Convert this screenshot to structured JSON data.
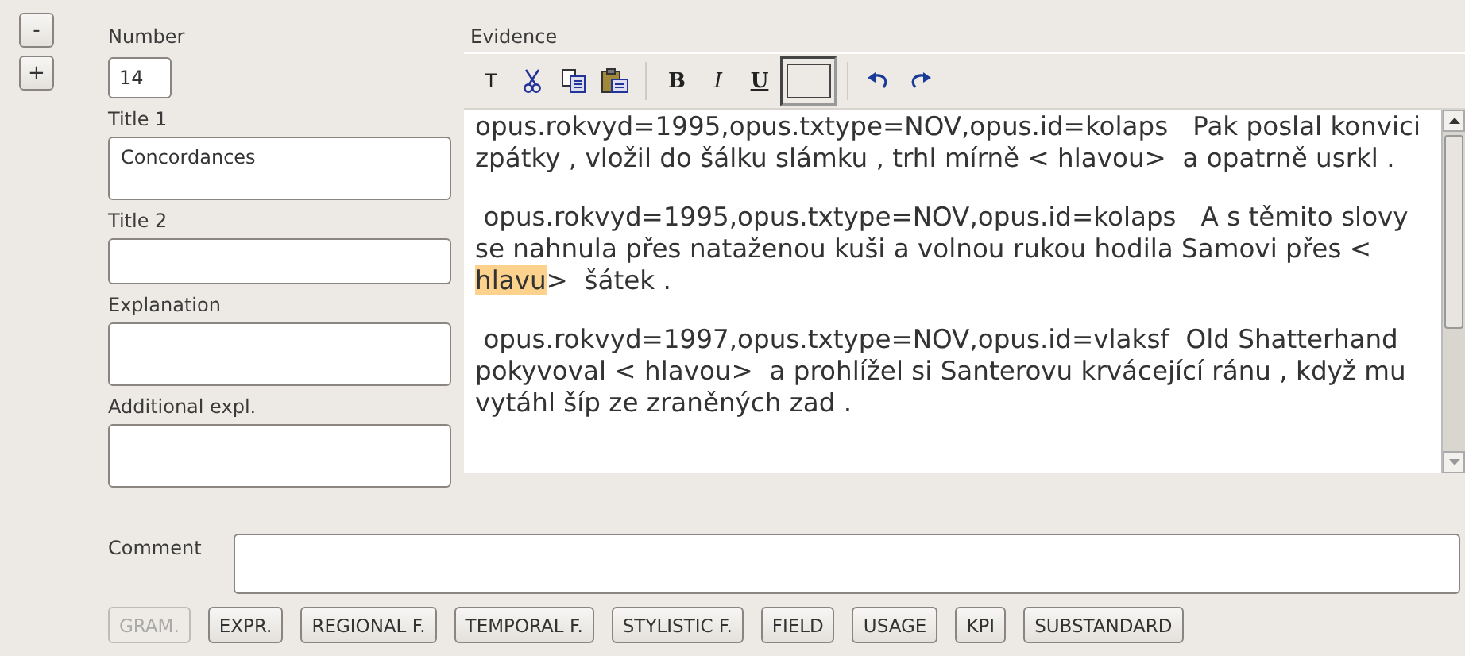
{
  "side_buttons": [
    "-",
    "+"
  ],
  "fields": [
    {
      "label": "Number",
      "value": "14",
      "kind": "short"
    },
    {
      "label": "Title 1",
      "value": "Concordances",
      "kind": "box"
    },
    {
      "label": "Title 2",
      "kind": "line"
    },
    {
      "label": "Explanation",
      "kind": "box"
    },
    {
      "label": "Additional expl.",
      "kind": "box"
    }
  ],
  "evidence": {
    "label": "Evidence",
    "toolbar": [
      {
        "kind": "text",
        "label": "T"
      },
      {
        "kind": "cut"
      },
      {
        "kind": "copy"
      },
      {
        "kind": "paste"
      },
      {
        "kind": "separator"
      },
      {
        "kind": "bold",
        "label": "B"
      },
      {
        "kind": "italic",
        "label": "I"
      },
      {
        "kind": "underline",
        "label": "U"
      },
      {
        "kind": "color",
        "selected": true
      },
      {
        "kind": "separator"
      },
      {
        "kind": "undo"
      },
      {
        "kind": "redo"
      }
    ],
    "paragraphs": [
      [
        {
          "text": "opus.rokvyd=1995,opus.txtype=NOV,opus.id=kolaps   Pak poslal konvici zpátky , vložil do šálku slámku , trhl mírně < hlavou>  a opatrně usrkl .",
          "highlighted": false
        }
      ],
      [
        {
          "text": " opus.rokvyd=1995,opus.txtype=NOV,opus.id=kolaps   A s těmito slovy se nahnula přes nataženou kuši a volnou rukou hodila Samovi přes < ",
          "highlighted": false
        },
        {
          "text": "hlavu",
          "highlighted": true
        },
        {
          "text": ">  šátek .",
          "highlighted": false
        }
      ],
      [
        {
          "text": " opus.rokvyd=1997,opus.txtype=NOV,opus.id=vlaksf  Old Shatterhand pokyvoval < hlavou>  a prohlížel si Santerovu krvácející ránu , když mu vytáhl šíp ze zraněných zad .",
          "highlighted": false
        }
      ]
    ]
  },
  "comment": {
    "label": "Comment"
  },
  "buttons": [
    {
      "label": "GRAM.",
      "disabled": true
    },
    {
      "label": "EXPR.",
      "disabled": false
    },
    {
      "label": "REGIONAL F.",
      "disabled": false
    },
    {
      "label": "TEMPORAL F.",
      "disabled": false
    },
    {
      "label": "STYLISTIC F.",
      "disabled": false
    },
    {
      "label": "FIELD",
      "disabled": false
    },
    {
      "label": "USAGE",
      "disabled": false
    },
    {
      "label": "KPI",
      "disabled": false
    },
    {
      "label": "SUBSTANDARD",
      "disabled": false
    }
  ]
}
